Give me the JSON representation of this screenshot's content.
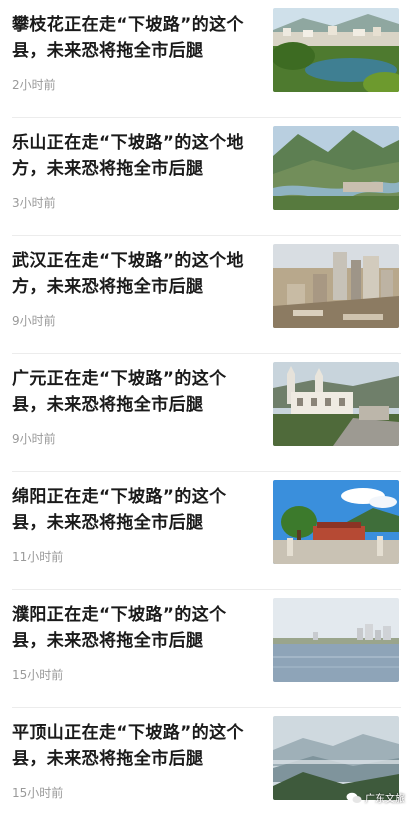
{
  "feed": {
    "items": [
      {
        "title": "攀枝花正在走“下坡路”的这个县，未来恐将拖全市后腿",
        "time": "2小时前",
        "image": "landscape-lake-town"
      },
      {
        "title": "乐山正在走“下坡路”的这个地方，未来恐将拖全市后腿",
        "time": "3小时前",
        "image": "river-valley-town"
      },
      {
        "title": "武汉正在走“下坡路”的这个地方，未来恐将拖全市后腿",
        "time": "9小时前",
        "image": "city-aerial"
      },
      {
        "title": "广元正在走“下坡路”的这个县，未来恐将拖全市后腿",
        "time": "9小时前",
        "image": "church-buildings"
      },
      {
        "title": "绵阳正在走“下坡路”的这个县，未来恐将拖全市后腿",
        "time": "11小时前",
        "image": "temple-gate"
      },
      {
        "title": "濮阳正在走“下坡路”的这个县，未来恐将拖全市后腿",
        "time": "15小时前",
        "image": "lakeside-skyline"
      },
      {
        "title": "平顶山正在走“下坡路”的这个县，未来恐将拖全市后腿",
        "time": "15小时前",
        "image": "misty-mountains"
      }
    ]
  },
  "watermark": {
    "text": "广东文旅"
  },
  "colors": {
    "title": "#1a1a1a",
    "time": "#9a9a9a",
    "divider": "#ececec",
    "background": "#ffffff"
  }
}
